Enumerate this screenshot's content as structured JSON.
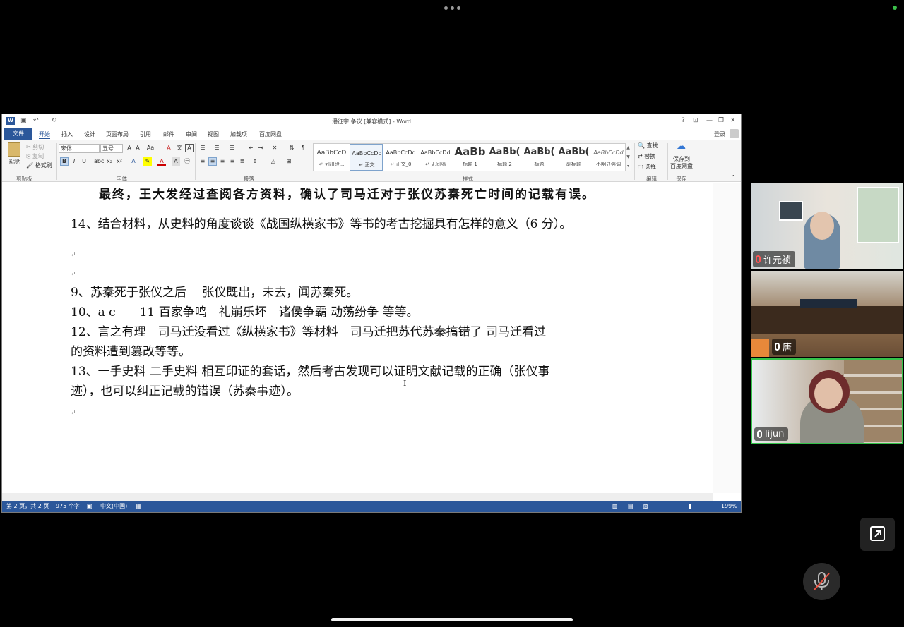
{
  "word": {
    "title": "潘征宇 争议 [兼容模式] - Word",
    "help": "?",
    "tabs": [
      "开始",
      "插入",
      "设计",
      "页面布局",
      "引用",
      "邮件",
      "审阅",
      "视图",
      "加载项",
      "百度网盘"
    ],
    "file_tab": "文件",
    "login": "登录",
    "ribbon": {
      "clipboard": {
        "paste": "粘贴",
        "cut": "剪切",
        "copy": "复制",
        "format_painter": "格式刷",
        "label": "剪贴板"
      },
      "font": {
        "family": "宋体",
        "size": "五号",
        "label": "字体"
      },
      "paragraph": {
        "label": "段落"
      },
      "styles": {
        "label": "样式",
        "items": [
          {
            "sample": "AaBbCcD",
            "name": "↵ 列出段..."
          },
          {
            "sample": "AaBbCcDd",
            "name": "↵ 正文"
          },
          {
            "sample": "AaBbCcDd",
            "name": "↵ 正文_0"
          },
          {
            "sample": "AaBbCcDd",
            "name": "↵ 无间隔"
          },
          {
            "sample": "AaBb",
            "name": "标题 1"
          },
          {
            "sample": "AaBb(",
            "name": "标题 2"
          },
          {
            "sample": "AaBb(",
            "name": "标题"
          },
          {
            "sample": "AaBb(",
            "name": "副标题"
          },
          {
            "sample": "AaBbCcDd",
            "name": "不明显强调"
          }
        ]
      },
      "editing": {
        "find": "查找",
        "replace": "替换",
        "select": "选择",
        "label": "编辑"
      },
      "save": {
        "line1": "保存到",
        "line2": "百度网盘",
        "label": "保存"
      }
    },
    "document": {
      "lines": [
        "最终，王大发经过查阅各方资料，确认了司马迁对于张仪苏秦死亡时间的记载有误。",
        "14、结合材料，从史料的角度谈谈《战国纵横家书》等书的考古挖掘具有怎样的意义（6 分）。",
        "9、苏秦死于张仪之后　 张仪既出，未去，闻苏秦死。",
        "10、a c　　11 百家争鸣　礼崩乐坏　诸侯争霸 动荡纷争 等等。",
        "12、言之有理　司马迁没看过《纵横家书》等材料　司马迁把苏代苏秦搞错了 司马迁看过",
        "的资料遭到篡改等等。",
        "13、一手史料 二手史料 相互印证的套话，然后考古发现可以证明文献记载的正确（张仪事",
        "迹），也可以纠正记载的错误（苏秦事迹）。"
      ],
      "para_mark": "↵"
    },
    "status": {
      "page": "第 2 页，共 2 页",
      "words": "975 个字",
      "language": "中文(中国)",
      "zoom": "199%"
    }
  },
  "participants": [
    {
      "name": "许元祯"
    },
    {
      "name": "唐"
    },
    {
      "name": "lijun"
    }
  ]
}
